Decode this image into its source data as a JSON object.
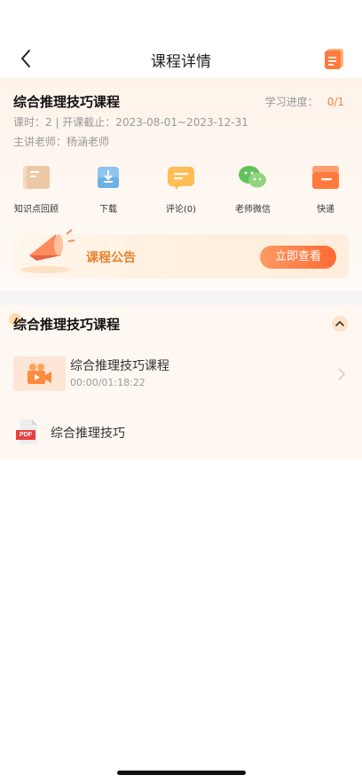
{
  "nav": {
    "title": "课程详情"
  },
  "course": {
    "title": "综合推理技巧课程",
    "progress_label": "学习进度：",
    "progress_value": "0/1",
    "meta_line1": "课时：2 | 开课截止：2023-08-01~2023-12-31",
    "meta_line2": "主讲老师：杨涵老师"
  },
  "actions": [
    {
      "label": "知识点回顾",
      "icon": "book-icon"
    },
    {
      "label": "下载",
      "icon": "download-icon"
    },
    {
      "label": "评论(0)",
      "icon": "comment-icon"
    },
    {
      "label": "老师微信",
      "icon": "wechat-icon"
    },
    {
      "label": "快递",
      "icon": "box-icon"
    }
  ],
  "notice": {
    "title": "课程公告",
    "button": "立即查看"
  },
  "chapter": {
    "title": "综合推理技巧课程",
    "lesson": {
      "title": "综合推理技巧课程",
      "time": "00:00/01:18:22"
    },
    "pdf": {
      "badge": "PDF",
      "label": "综合推理技巧"
    }
  },
  "colors": {
    "accent": "#ff7a3d",
    "notice_text": "#e8822f"
  }
}
